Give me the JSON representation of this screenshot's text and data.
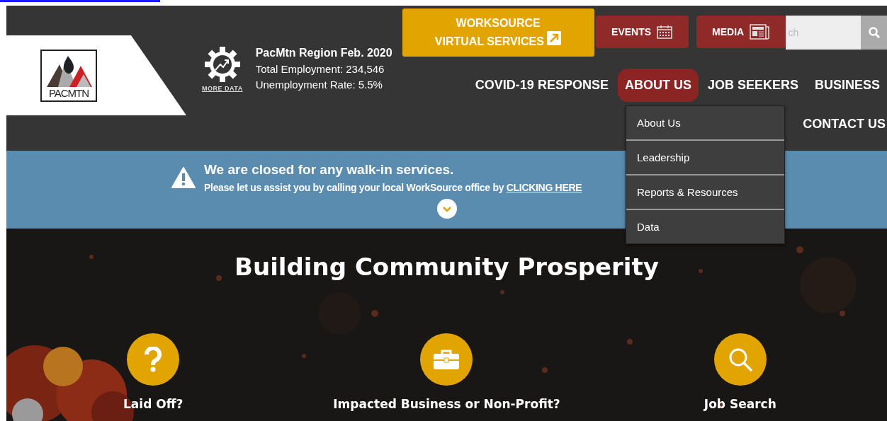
{
  "logo": {
    "text": "PACMTN"
  },
  "stats": {
    "more_data": "MORE DATA",
    "title": "PacMtn Region Feb. 2020",
    "lines": [
      "Total Employment: 234,546",
      "Unemployment Rate: 5.5%"
    ]
  },
  "top_buttons": [
    {
      "label": "WORKSOURCE VIRTUAL SERVICES",
      "kind": "external"
    },
    {
      "label": "EVENTS",
      "kind": "calendar"
    },
    {
      "label": "MEDIA",
      "kind": "news"
    }
  ],
  "search": {
    "placeholder": "ch"
  },
  "nav": [
    {
      "label": "COVID-19 RESPONSE",
      "selected": false
    },
    {
      "label": "ABOUT US",
      "selected": true
    },
    {
      "label": "JOB SEEKERS",
      "selected": false
    },
    {
      "label": "BUSINESS",
      "selected": false
    },
    {
      "label": "CONTACT US",
      "selected": false
    }
  ],
  "dropdown": [
    "About Us",
    "Leadership",
    "Reports & Resources",
    "Data"
  ],
  "alert": {
    "title": "We are closed for any walk-in services.",
    "text": "Please let us assist you by calling your local WorkSource office by ",
    "link": "CLICKING HERE"
  },
  "hero": {
    "title": "Building Community Prosperity",
    "cards": [
      {
        "label": "Laid Off?",
        "kind": "question"
      },
      {
        "label": "Impacted Business or Non-Profit?",
        "kind": "briefcase"
      },
      {
        "label": "Job Search",
        "kind": "search"
      }
    ]
  }
}
